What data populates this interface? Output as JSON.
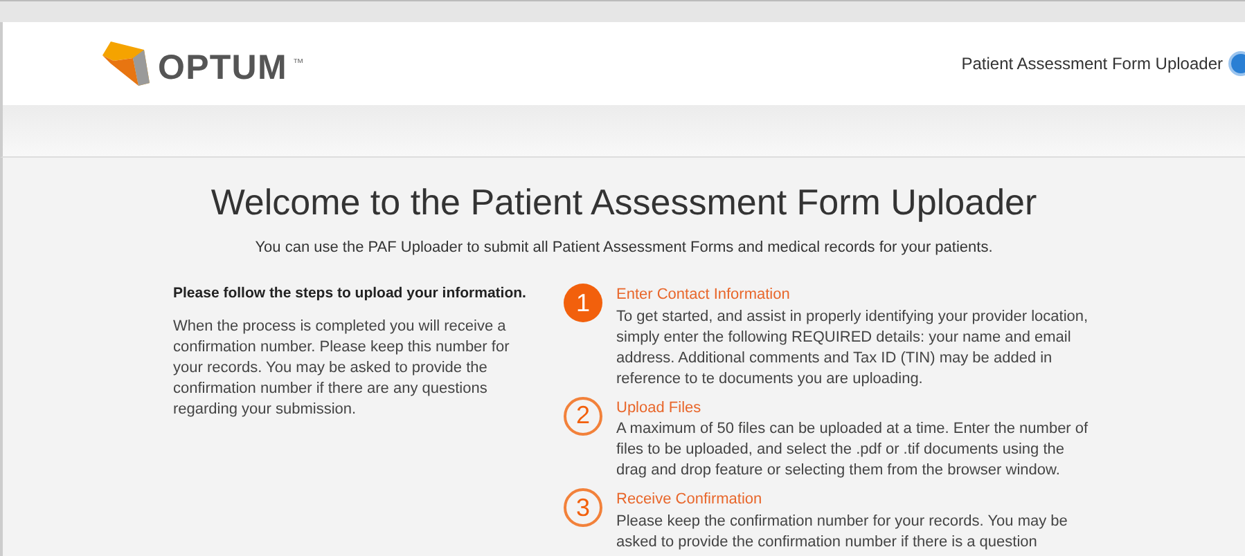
{
  "header": {
    "logo_text": "OPTUM",
    "trademark": "™",
    "app_title": "Patient Assessment Form Uploader"
  },
  "main": {
    "title": "Welcome to the Patient Assessment Form Uploader",
    "subtitle": "You can use the PAF Uploader to submit all Patient Assessment Forms and medical records for your patients."
  },
  "intro": {
    "heading": "Please follow the steps to upload your information.",
    "body": "When the process is completed you will receive a confirmation number. Please keep this number for your records. You may be asked to provide the confirmation number if there are any questions regarding your submission."
  },
  "steps": [
    {
      "number": "1",
      "title": "Enter Contact Information",
      "selected": true,
      "body": "To get started, and assist in properly identifying your provider location, simply enter the following REQUIRED details: your name and email address. Additional comments and Tax ID (TIN) may be added in reference to te documents you are uploading."
    },
    {
      "number": "2",
      "title": "Upload Files",
      "selected": false,
      "body": "A maximum of 50 files can be uploaded at a time. Enter the number of files to be uploaded, and select the .pdf or .tif documents using the drag and drop feature or selecting them from the browser window."
    },
    {
      "number": "3",
      "title": "Receive Confirmation",
      "selected": false,
      "body": "Please keep the confirmation number for your records. You may be asked to provide the confirmation number if there is a question"
    }
  ]
}
